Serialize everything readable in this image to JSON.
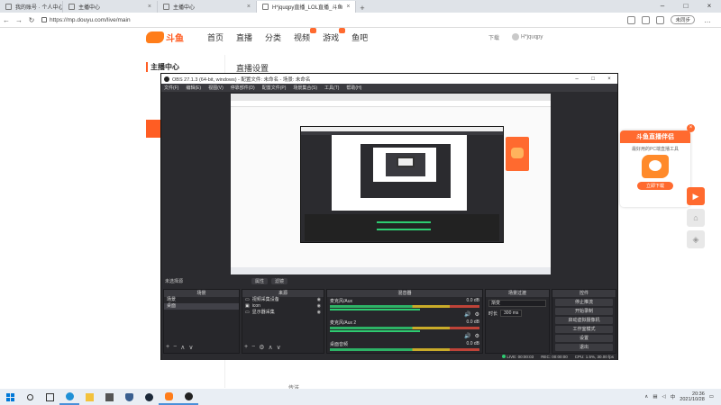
{
  "browser": {
    "tabs": [
      {
        "label": "我的账号 · 个人中心 · 斗鱼",
        "active": false
      },
      {
        "label": "主播中心",
        "active": false
      },
      {
        "label": "主播中心",
        "active": true
      },
      {
        "label": "H*jquqpy直播_LOL直播_斗鱼",
        "active": false
      }
    ],
    "url": "https://mp.douyu.com/live/main",
    "login_label": "未同步"
  },
  "site": {
    "logo_text": "斗鱼",
    "nav": [
      "首页",
      "直播",
      "分类",
      "视频",
      "游戏",
      "鱼吧"
    ],
    "header_right": [
      "下载",
      "H*jquqpy"
    ],
    "sidebar_title": "主播中心",
    "content_title": "直播设置",
    "footer_link": "传送"
  },
  "promo": {
    "title": "斗鱼直播伴侣",
    "subtitle": "最好用的PC端直播工具",
    "button": "立即下载"
  },
  "obs": {
    "title": "OBS 27.1.3 (64-bit, windows) - 配置文件: 未命名 - 场景: 未命名",
    "menu": [
      "文件(F)",
      "编辑(E)",
      "视图(V)",
      "停靠部件(D)",
      "配置文件(P)",
      "场景集合(S)",
      "工具(T)",
      "帮助(H)"
    ],
    "transition_label": "未选择源",
    "transition_buttons": [
      "属性",
      "滤镜"
    ],
    "docks": {
      "scenes": {
        "title": "场景",
        "items": [
          "场景",
          "桌面"
        ]
      },
      "sources": {
        "title": "来源",
        "items": [
          "视频采集设备",
          "icon",
          "显示器采集"
        ]
      },
      "mixer": {
        "title": "混音器",
        "channels": [
          {
            "name": "麦克风/Aux",
            "db": "0.0 dB"
          },
          {
            "name": "麦克风/Aux 2",
            "db": "0.0 dB"
          },
          {
            "name": "桌面音频",
            "db": "0.0 dB"
          }
        ]
      },
      "transitions": {
        "title": "场景过渡",
        "type": "渐变",
        "duration_label": "时长",
        "duration": "300 ms"
      },
      "controls": {
        "title": "控件",
        "buttons": [
          "停止推流",
          "开始录制",
          "启动虚拟摄像机",
          "工作室模式",
          "设置",
          "退出"
        ]
      }
    },
    "status": [
      "LIVE: 00:00:03",
      "REC: 00:00:00",
      "CPU: 1.5%, 30.00 fps"
    ]
  },
  "taskbar": {
    "time": "20:36",
    "date": "2021/10/28"
  }
}
